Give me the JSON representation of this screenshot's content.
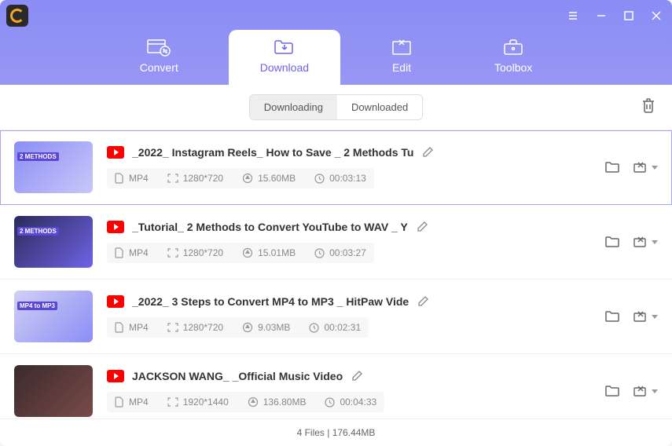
{
  "nav": {
    "convert": "Convert",
    "download": "Download",
    "edit": "Edit",
    "toolbox": "Toolbox"
  },
  "subtabs": {
    "downloading": "Downloading",
    "downloaded": "Downloaded"
  },
  "items": [
    {
      "title": "_2022_ Instagram Reels_ How to Save _ 2 Methods Tu",
      "format": "MP4",
      "resolution": "1280*720",
      "size": "15.60MB",
      "duration": "00:03:13"
    },
    {
      "title": "_Tutorial_ 2 Methods to Convert YouTube to WAV _ Y",
      "format": "MP4",
      "resolution": "1280*720",
      "size": "15.01MB",
      "duration": "00:03:27"
    },
    {
      "title": "_2022_ 3 Steps to Convert MP4 to MP3 _ HitPaw Vide",
      "format": "MP4",
      "resolution": "1280*720",
      "size": "9.03MB",
      "duration": "00:02:31"
    },
    {
      "title": "JACKSON WANG_ _Official Music Video",
      "format": "MP4",
      "resolution": "1920*1440",
      "size": "136.80MB",
      "duration": "00:04:33"
    }
  ],
  "footer": "4 Files | 176.44MB",
  "thumb_labels": [
    "2 METHODS",
    "2 METHODS",
    "MP4 to MP3",
    ""
  ]
}
